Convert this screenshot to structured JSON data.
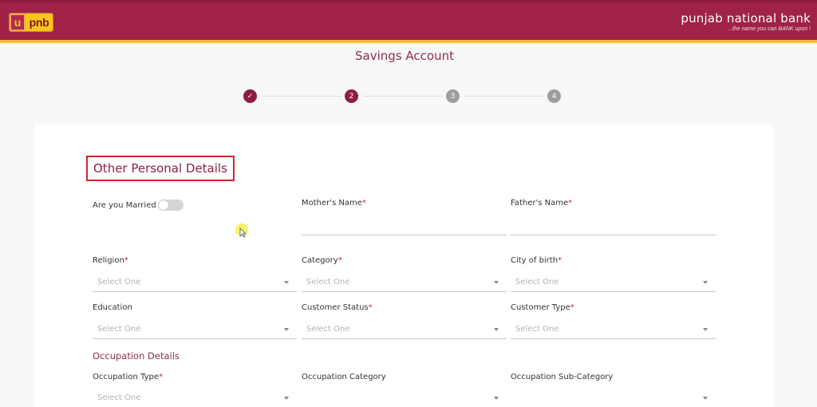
{
  "header": {
    "logo_mark": "u",
    "logo_text": "pnb",
    "brand_name": "punjab national bank",
    "brand_tagline": "...the name you can BANK upon !",
    "colors": {
      "primary": "#a02246",
      "accent": "#f7b12a"
    }
  },
  "page": {
    "title": "Savings Account"
  },
  "stepper": {
    "steps": [
      {
        "label": "✓",
        "state": "done"
      },
      {
        "label": "2",
        "state": "active"
      },
      {
        "label": "3",
        "state": "pending"
      },
      {
        "label": "4",
        "state": "pending"
      }
    ]
  },
  "form": {
    "section_title": "Other Personal Details",
    "required_marker": "*",
    "married": {
      "label": "Are you Married ?",
      "value": false
    },
    "mothers_name": {
      "label": "Mother's Name",
      "value": ""
    },
    "fathers_name": {
      "label": "Father's Name",
      "value": ""
    },
    "religion": {
      "label": "Religion",
      "value": "Select One"
    },
    "category": {
      "label": "Category",
      "value": "Select One"
    },
    "city_of_birth": {
      "label": "City of birth",
      "value": "Select One"
    },
    "education": {
      "label": "Education",
      "value": "Select One"
    },
    "customer_status": {
      "label": "Customer Status",
      "value": "Select One"
    },
    "customer_type": {
      "label": "Customer Type",
      "value": "Select One"
    },
    "occupation_section": "Occupation Details",
    "occupation_type": {
      "label": "Occupation Type",
      "value": "Select One"
    },
    "occupation_category": {
      "label": "Occupation Category",
      "value": ""
    },
    "occupation_sub_category": {
      "label": "Occupation Sub-Category",
      "value": ""
    }
  }
}
